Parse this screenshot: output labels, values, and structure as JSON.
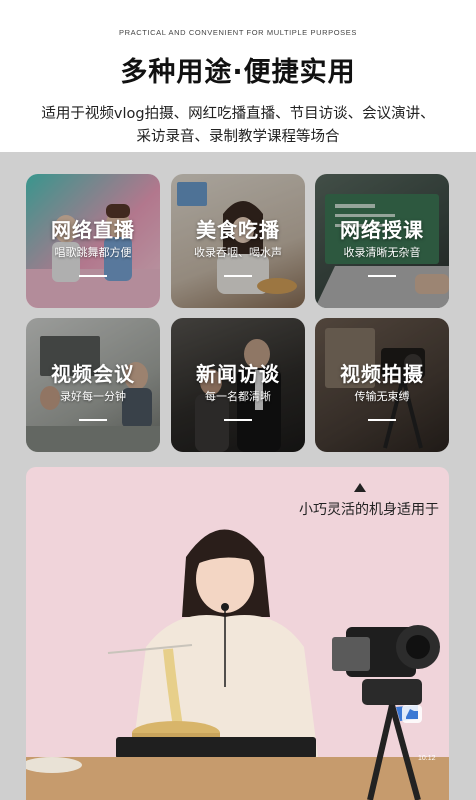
{
  "header": {
    "eyebrow": "PRACTICAL AND CONVENIENT FOR MULTIPLE PURPOSES",
    "title": "多种用途·便捷实用",
    "desc_line1": "适用于视频vlog拍摄、网红吃播直播、节目访谈、会议演讲、",
    "desc_line2": "采访录音、录制教学课程等场合"
  },
  "tiles": [
    {
      "title": "网络直播",
      "subtitle": "唱歌跳舞都方便"
    },
    {
      "title": "美食吃播",
      "subtitle": "收录吞咽、喝水声"
    },
    {
      "title": "网络授课",
      "subtitle": "收录清晰无杂音"
    },
    {
      "title": "视频会议",
      "subtitle": "录好每一分钟"
    },
    {
      "title": "新闻访谈",
      "subtitle": "每一名都清晰"
    },
    {
      "title": "视频拍摄",
      "subtitle": "传输无束缚"
    }
  ],
  "hero": {
    "caption": "小巧灵活的机身适用于",
    "camera_screen_time": "10:12"
  },
  "colors": {
    "grey_band": "#cfcfcf",
    "hero_bg": "#f0d4da"
  }
}
